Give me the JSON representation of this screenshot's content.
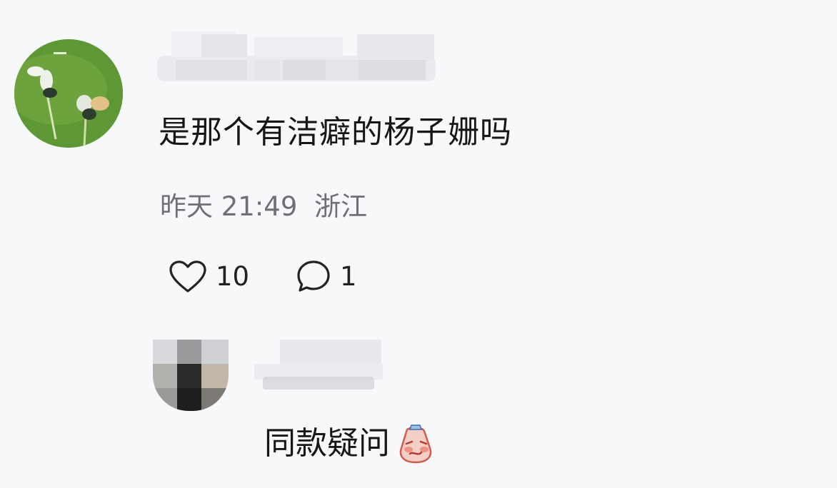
{
  "comment": {
    "text": "是那个有洁癖的杨子姗吗",
    "timestamp": "昨天 21:49",
    "location": "浙江",
    "like_count": "10",
    "reply_count": "1",
    "icons": {
      "like": "heart-outline-icon",
      "reply": "speech-bubble-icon"
    }
  },
  "reply": {
    "text": "同款疑问",
    "emoji": "shy-face-emoji-icon"
  },
  "colors": {
    "background": "#f7f8fa",
    "text": "#171717",
    "meta": "#6f6f76"
  }
}
